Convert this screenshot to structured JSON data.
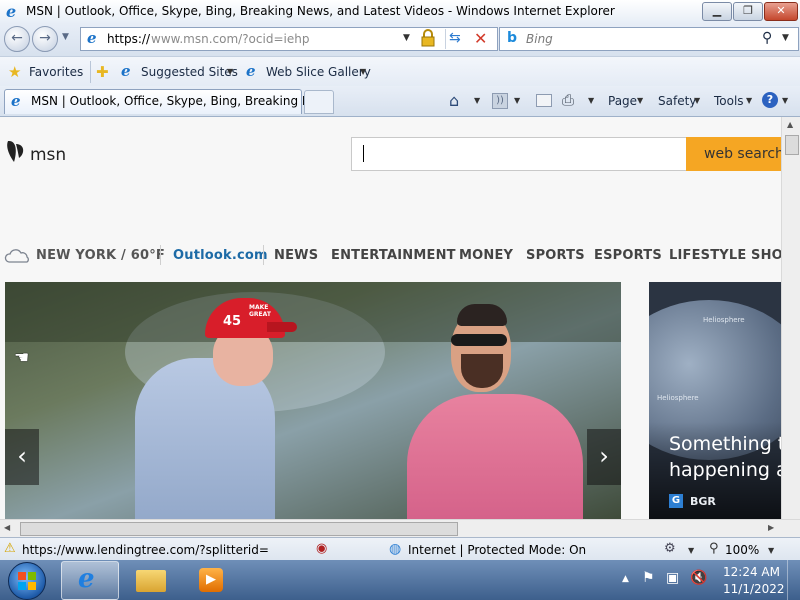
{
  "window": {
    "title": "MSN | Outlook, Office, Skype, Bing, Breaking News, and Latest Videos - Windows Internet Explorer",
    "minimize_glyph": "▁",
    "maximize_glyph": "❐",
    "close_glyph": "✕"
  },
  "addressbar": {
    "scheme": "https://",
    "rest": "www.msn.com/?ocid=iehp",
    "search_placeholder": "Bing"
  },
  "favorites": {
    "favorites_label": "Favorites",
    "suggested_sites_label": "Suggested Sites",
    "web_slice_gallery_label": "Web Slice Gallery"
  },
  "tabs": {
    "active_tab_label": "MSN | Outlook, Office, Skype, Bing, Breaking Ne..."
  },
  "commandbar": {
    "page_label": "Page",
    "safety_label": "Safety",
    "tools_label": "Tools",
    "help_glyph": "?"
  },
  "msn": {
    "logo_text": "msn",
    "search_button_label": "web search",
    "weather_label": "NEW YORK / 60°F",
    "nav": {
      "outlook": "Outlook.com",
      "news": "NEWS",
      "entertainment": "ENTERTAINMENT",
      "money": "MONEY",
      "sports": "SPORTS",
      "esports": "ESPORTS",
      "lifestyle": "LIFESTYLE",
      "shopping_clipped": "SHOI"
    },
    "hero": {
      "cap_number": "45",
      "cap_text": "MAKE GREAT"
    },
    "side_card": {
      "title_line1": "Something to",
      "title_line2": "happening at",
      "source_label": "BGR",
      "image_text1": "Heliosphere",
      "image_text2": "Heliosphere"
    }
  },
  "statusbar": {
    "link_url": "https://www.lendingtree.com/?splitterid=",
    "zone_text": "Internet | Protected Mode: On",
    "zoom_text": "100%"
  },
  "taskbar": {
    "clock_time": "12:24 AM",
    "clock_date": "11/1/2022"
  },
  "colors": {
    "msn_search_button": "#f5a623",
    "outlook_link": "#1c6aa6",
    "hero_shirt_pink": "#e0709c",
    "side_card_bg": "#2b3442"
  }
}
